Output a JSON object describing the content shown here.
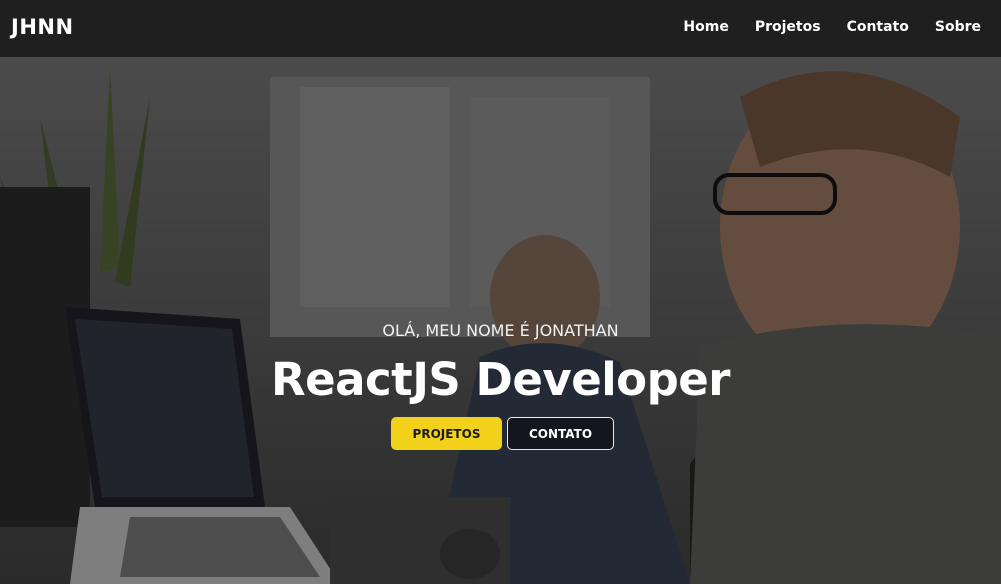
{
  "navbar": {
    "brand": "JHNN",
    "links": [
      "Home",
      "Projetos",
      "Contato",
      "Sobre"
    ]
  },
  "hero": {
    "greeting": "OLÁ, MEU NOME É JONATHAN",
    "headline": "ReactJS Developer",
    "buttons": {
      "primary": "PROJETOS",
      "secondary": "CONTATO"
    }
  },
  "colors": {
    "accent": "#f1d11a",
    "navbar_bg": "#1f1f1f",
    "text": "#ffffff"
  },
  "icons": [
    "hero-background-photo"
  ]
}
